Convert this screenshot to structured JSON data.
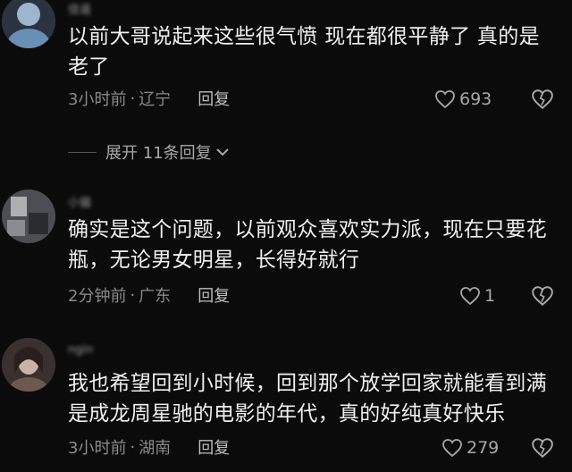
{
  "comments": [
    {
      "username": "佳遥",
      "text": "以前大哥说起来这些很气愤 现在都很平静了 真的是老了",
      "time": "3小时前",
      "location": "辽宁",
      "reply_label": "回复",
      "likes": "693",
      "avatar_icon": "user-avatar-blurred",
      "avatar_color": "#7aa0c4"
    },
    {
      "username": "小猫",
      "text": "确实是这个问题，以前观众喜欢实力派，现在只要花瓶，无论男女明星，长得好就行",
      "time": "2分钟前",
      "location": "广东",
      "reply_label": "回复",
      "likes": "1",
      "avatar_icon": "user-avatar-blurred",
      "avatar_color": "#8b8f96"
    },
    {
      "username": "ngin",
      "text": "我也希望回到小时候，回到那个放学回家就能看到满是成龙周星驰的电影的年代，真的好纯真好快乐",
      "time": "3小时前",
      "location": "湖南",
      "reply_label": "回复",
      "likes": "279",
      "avatar_icon": "user-avatar-blurred",
      "avatar_color": "#b49a8a"
    }
  ],
  "expand_replies": {
    "label": "展开 11条回复",
    "icon": "chevron-down-icon"
  },
  "separator": "·",
  "icons": {
    "like": "heart-outline-icon",
    "dislike": "broken-heart-icon"
  }
}
